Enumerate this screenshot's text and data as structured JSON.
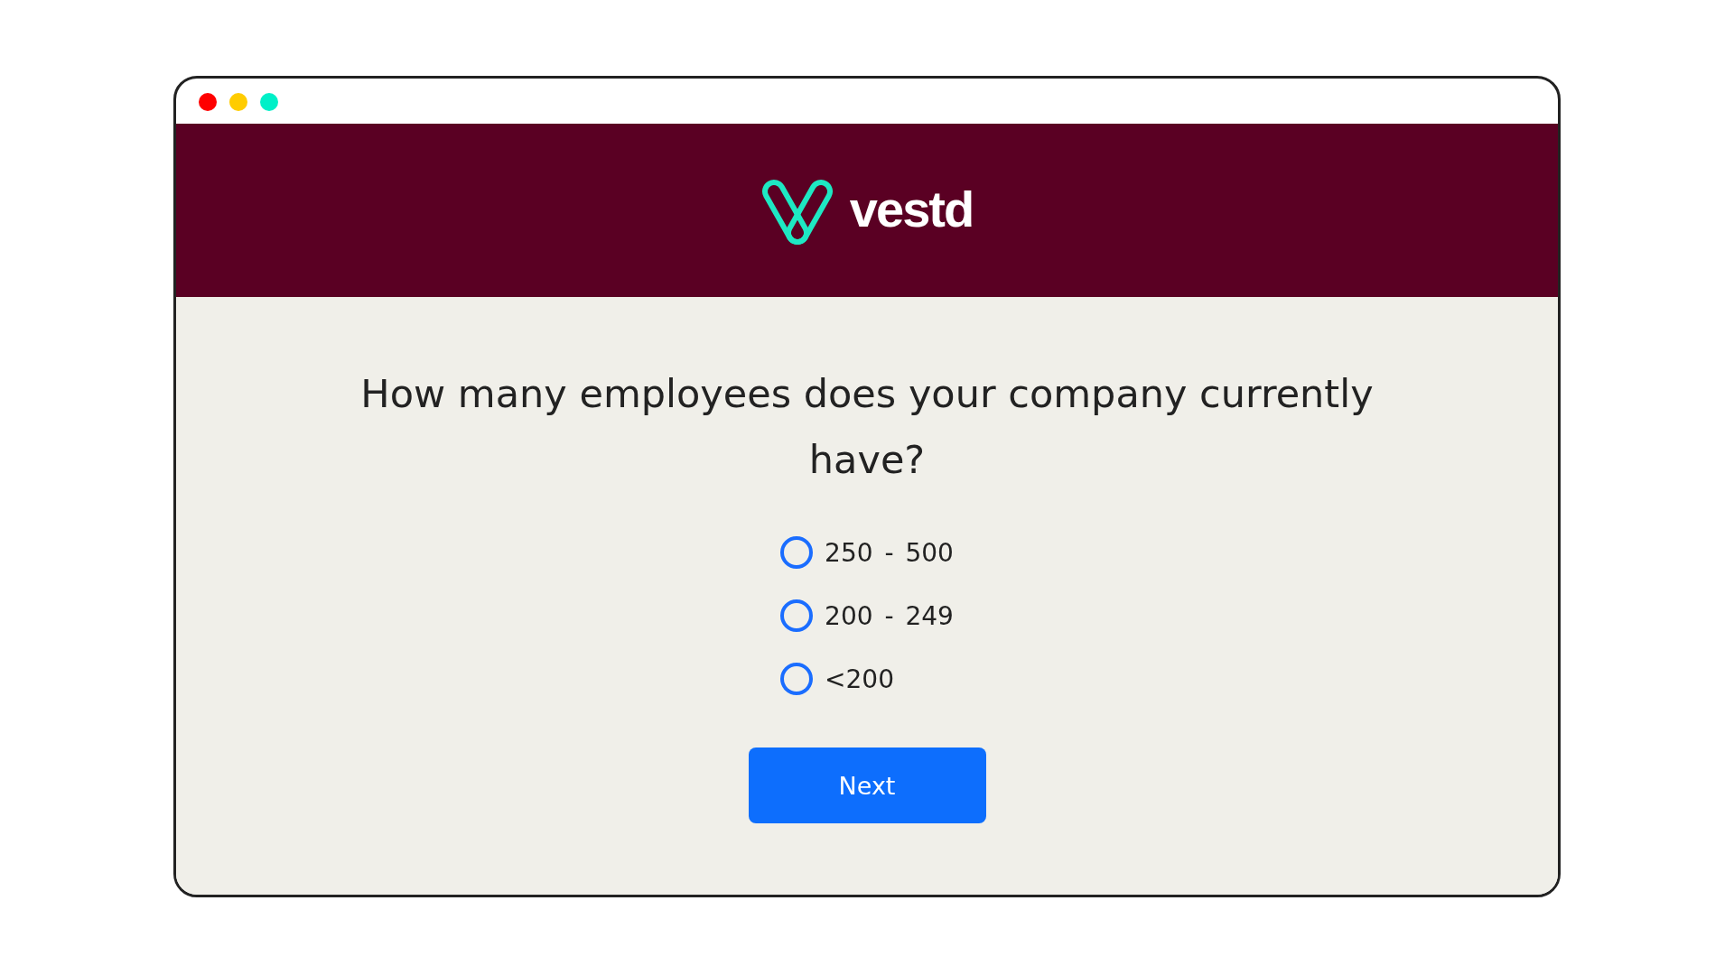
{
  "window": {
    "controls": [
      {
        "color": "#ff0000"
      },
      {
        "color": "#ffcc00"
      },
      {
        "color": "#00f0c8"
      }
    ]
  },
  "header": {
    "brand": "vestd"
  },
  "question": "How many employees does your company currently have?",
  "options": [
    {
      "label": "250 - 500",
      "selected": false
    },
    {
      "label": "200 - 249",
      "selected": false
    },
    {
      "label": "<200",
      "selected": false
    }
  ],
  "next_button": "Next"
}
